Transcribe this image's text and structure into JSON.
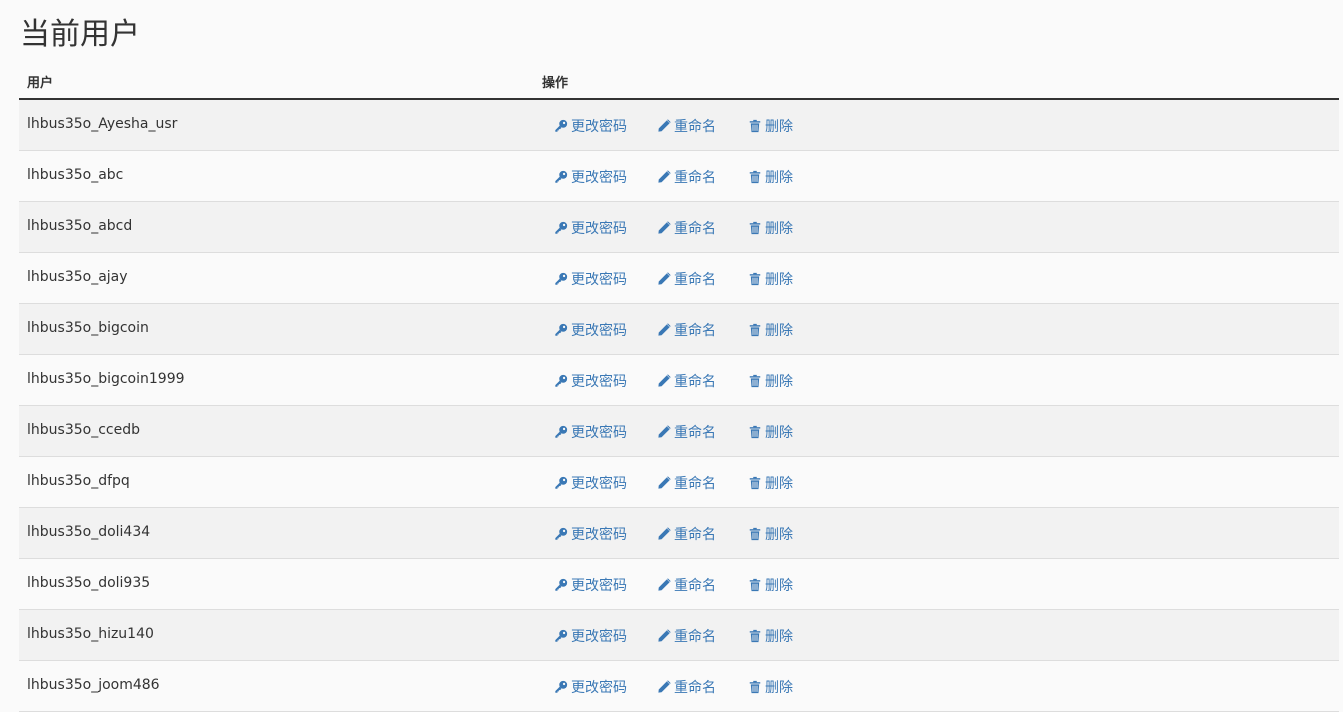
{
  "page": {
    "title": "当前用户"
  },
  "table": {
    "headers": {
      "user": "用户",
      "actions": "操作"
    },
    "actions": {
      "change_password": "更改密码",
      "rename": "重命名",
      "delete": "删除"
    },
    "link_color": "#3a78b5",
    "rows": [
      "lhbus35o_Ayesha_usr",
      "lhbus35o_abc",
      "lhbus35o_abcd",
      "lhbus35o_ajay",
      "lhbus35o_bigcoin",
      "lhbus35o_bigcoin1999",
      "lhbus35o_ccedb",
      "lhbus35o_dfpq",
      "lhbus35o_doli434",
      "lhbus35o_doli935",
      "lhbus35o_hizu140",
      "lhbus35o_joom486"
    ]
  },
  "icons": {
    "change_password": "key-icon",
    "rename": "pencil-icon",
    "delete": "trash-icon"
  }
}
